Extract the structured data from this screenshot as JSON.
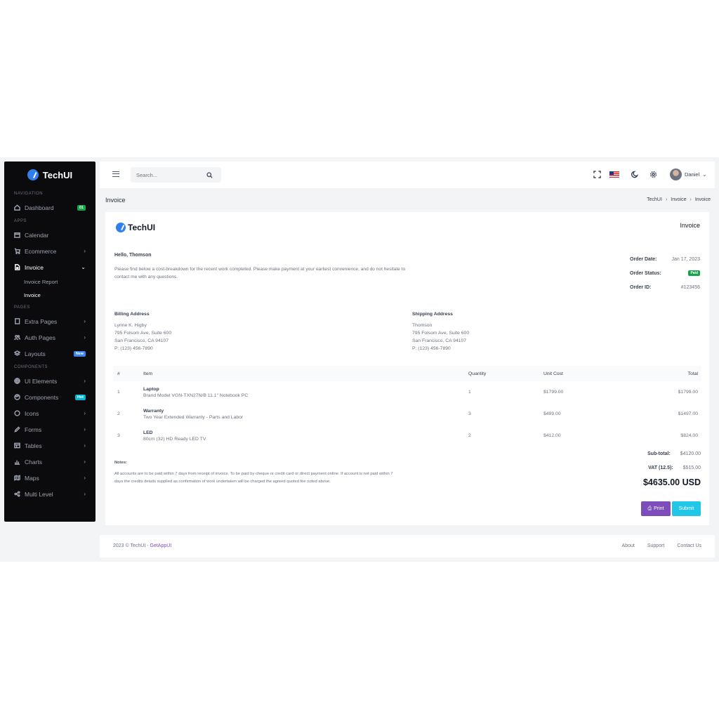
{
  "brand": {
    "name": "TechUI"
  },
  "sidebar": {
    "sections": {
      "navigation": "NAVIGATION",
      "apps": "APPS",
      "pages": "PAGES",
      "components": "COMPONENTS"
    },
    "dashboard": {
      "label": "Dashboard",
      "badge": "01"
    },
    "calendar": {
      "label": "Calendar"
    },
    "ecommerce": {
      "label": "Ecommerce"
    },
    "invoice": {
      "label": "Invoice"
    },
    "invoice_report": {
      "label": "Invoice Report"
    },
    "invoice_sub": {
      "label": "Invoice"
    },
    "extra_pages": {
      "label": "Extra Pages"
    },
    "auth_pages": {
      "label": "Auth Pages"
    },
    "layouts": {
      "label": "Layouts",
      "badge": "New"
    },
    "ui_elements": {
      "label": "UI Elements"
    },
    "components": {
      "label": "Components",
      "badge": "Hot"
    },
    "icons": {
      "label": "Icons"
    },
    "forms": {
      "label": "Forms"
    },
    "tables": {
      "label": "Tables"
    },
    "charts": {
      "label": "Charts"
    },
    "maps": {
      "label": "Maps"
    },
    "multi_level": {
      "label": "Multi Level"
    }
  },
  "topbar": {
    "search_placeholder": "Search...",
    "user_name": "Daniel",
    "user_caret": "⌄"
  },
  "page": {
    "title": "Invoice",
    "breadcrumb": [
      "TechUI",
      "Invoice",
      "Invoice"
    ],
    "breadcrumb_sep": "›"
  },
  "invoice": {
    "logo_text": "TechUI",
    "title": "Invoice",
    "greeting": "Hello, Thomson",
    "intro": "Please find below a cost-breakdown for the recent work completed. Please make payment at your earliest convenience, and do not hesitate to contact me with any questions.",
    "order_date_label": "Order Date:",
    "order_date": "Jan 17, 2023",
    "order_status_label": "Order Status:",
    "order_status": "Paid",
    "order_id_label": "Order ID:",
    "order_id": "#123456",
    "billing": {
      "title": "Billing Address",
      "name": "Lynne K. Higby",
      "street": "795 Folsom Ave, Suite 600",
      "city": "San Francisco, CA 94107",
      "phone": "P: (123) 456-7890"
    },
    "shipping": {
      "title": "Shipping Address",
      "name": "Thomson",
      "street": "795 Folsom Ave, Suite 600",
      "city": "San Francisco, CA 94107",
      "phone": "P: (123) 456-7890"
    },
    "table": {
      "headers": {
        "num": "#",
        "item": "Item",
        "qty": "Quantity",
        "unit": "Unit Cost",
        "total": "Total"
      },
      "rows": [
        {
          "num": "1",
          "name": "Laptop",
          "desc": "Brand Model VGN-TXN27N/B 11.1\" Notebook PC",
          "qty": "1",
          "unit": "$1799.00",
          "total": "$1799.00"
        },
        {
          "num": "2",
          "name": "Warranty",
          "desc": "Two Year Extended Warranty - Parts and Labor",
          "qty": "3",
          "unit": "$499.00",
          "total": "$1497.00"
        },
        {
          "num": "3",
          "name": "LED",
          "desc": "80cm (32) HD Ready LED TV",
          "qty": "2",
          "unit": "$412.00",
          "total": "$824.00"
        }
      ]
    },
    "notes_title": "Notes:",
    "notes": "All accounts are to be paid within 7 days from receipt of invoice. To be paid by cheque or credit card or direct payment online. If account is not paid within 7 days the credits details supplied as confirmation of work undertaken will be charged the agreed quoted fee noted above.",
    "subtotal_label": "Sub-total:",
    "subtotal": "$4120.00",
    "vat_label": "VAT (12.5):",
    "vat": "$515.00",
    "grand_total": "$4635.00 USD",
    "print_label": "Print",
    "submit_label": "Submit"
  },
  "footer": {
    "copyright": "2023 © TechUI - ",
    "link": "GetAppUI",
    "links": [
      "About",
      "Support",
      "Contact Us"
    ]
  },
  "colors": {
    "primary": "#7c4dbb",
    "info": "#22c7e8",
    "success": "#16a34a",
    "sidebar_bg": "#0b0b0d"
  }
}
